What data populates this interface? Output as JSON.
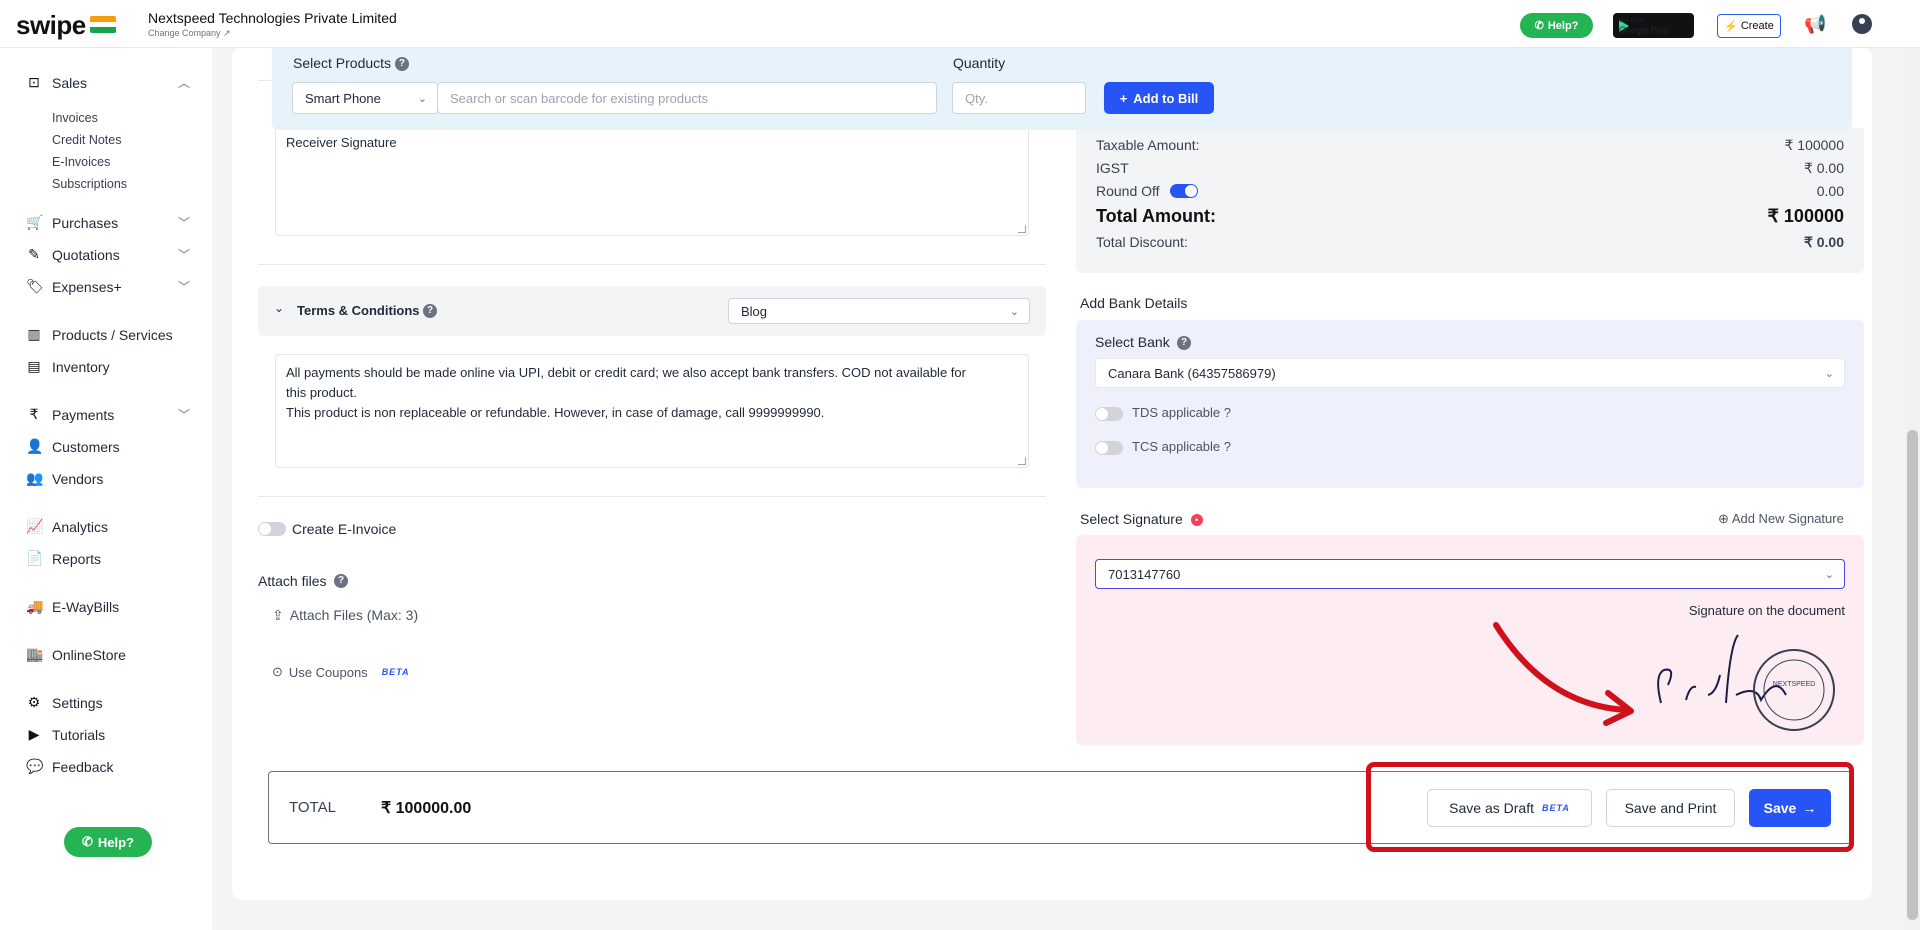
{
  "header": {
    "logo": "swipe",
    "company_name": "Nextspeed Technologies Private Limited",
    "change_company": "Change Company ↗",
    "help_label": "Help?",
    "gplay_small": "GET IT ON",
    "gplay_label": "Google Play",
    "create_label": "Create"
  },
  "sidebar": {
    "sales": "Sales",
    "sales_sub": [
      "Invoices",
      "Credit Notes",
      "E-Invoices",
      "Subscriptions"
    ],
    "purchases": "Purchases",
    "quotations": "Quotations",
    "expenses": "Expenses+",
    "products": "Products / Services",
    "inventory": "Inventory",
    "payments": "Payments",
    "customers": "Customers",
    "vendors": "Vendors",
    "analytics": "Analytics",
    "reports": "Reports",
    "ewaybills": "E-WayBills",
    "onlinestore": "OnlineStore",
    "settings": "Settings",
    "tutorials": "Tutorials",
    "feedback": "Feedback",
    "help_label": "Help?"
  },
  "products_bar": {
    "select_label": "Select Products",
    "category_value": "Smart Phone",
    "search_placeholder": "Search or scan barcode for existing products",
    "quantity_label": "Quantity",
    "qty_placeholder": "Qty.",
    "add_label": "Add to Bill"
  },
  "left": {
    "receiver_signature": "Receiver Signature",
    "terms_title": "Terms & Conditions",
    "terms_template": "Blog",
    "terms_line1": "All payments should be made online via UPI, debit or credit card; we also accept bank transfers. COD not available for",
    "terms_line2": "this product.",
    "terms_line3": "This product is non replaceable or refundable. However, in case of damage, call 9999999990.",
    "create_einvoice": "Create E-Invoice",
    "attach_files": "Attach files",
    "attach_button": "Attach Files (Max: 3)",
    "use_coupons": "Use Coupons",
    "beta": "BETA"
  },
  "summary": {
    "taxable_label": "Taxable Amount:",
    "taxable_value": "₹ 100000",
    "igst_label": "IGST",
    "igst_value": "₹ 0.00",
    "roundoff_label": "Round Off",
    "roundoff_value": "0.00",
    "total_label": "Total Amount:",
    "total_value": "₹ 100000",
    "discount_label": "Total Discount:",
    "discount_value": "₹ 0.00"
  },
  "bank": {
    "title": "Add Bank Details",
    "select_label": "Select Bank",
    "selected_bank": "Canara Bank (64357586979)",
    "tds": "TDS applicable ?",
    "tcs": "TCS applicable ?"
  },
  "signature": {
    "title": "Select Signature",
    "add_new": "Add New Signature",
    "selected": "7013147760",
    "caption": "Signature on the document",
    "stamp_text": "NEXTSPEED"
  },
  "footer": {
    "total_label": "TOTAL",
    "total_value": "₹ 100000.00",
    "draft_label": "Save as Draft",
    "beta": "BETA",
    "print_label": "Save and Print",
    "save_label": "Save"
  },
  "colors": {
    "primary": "#2754f5",
    "whatsapp": "#25b454",
    "highlight": "#d0111c"
  }
}
